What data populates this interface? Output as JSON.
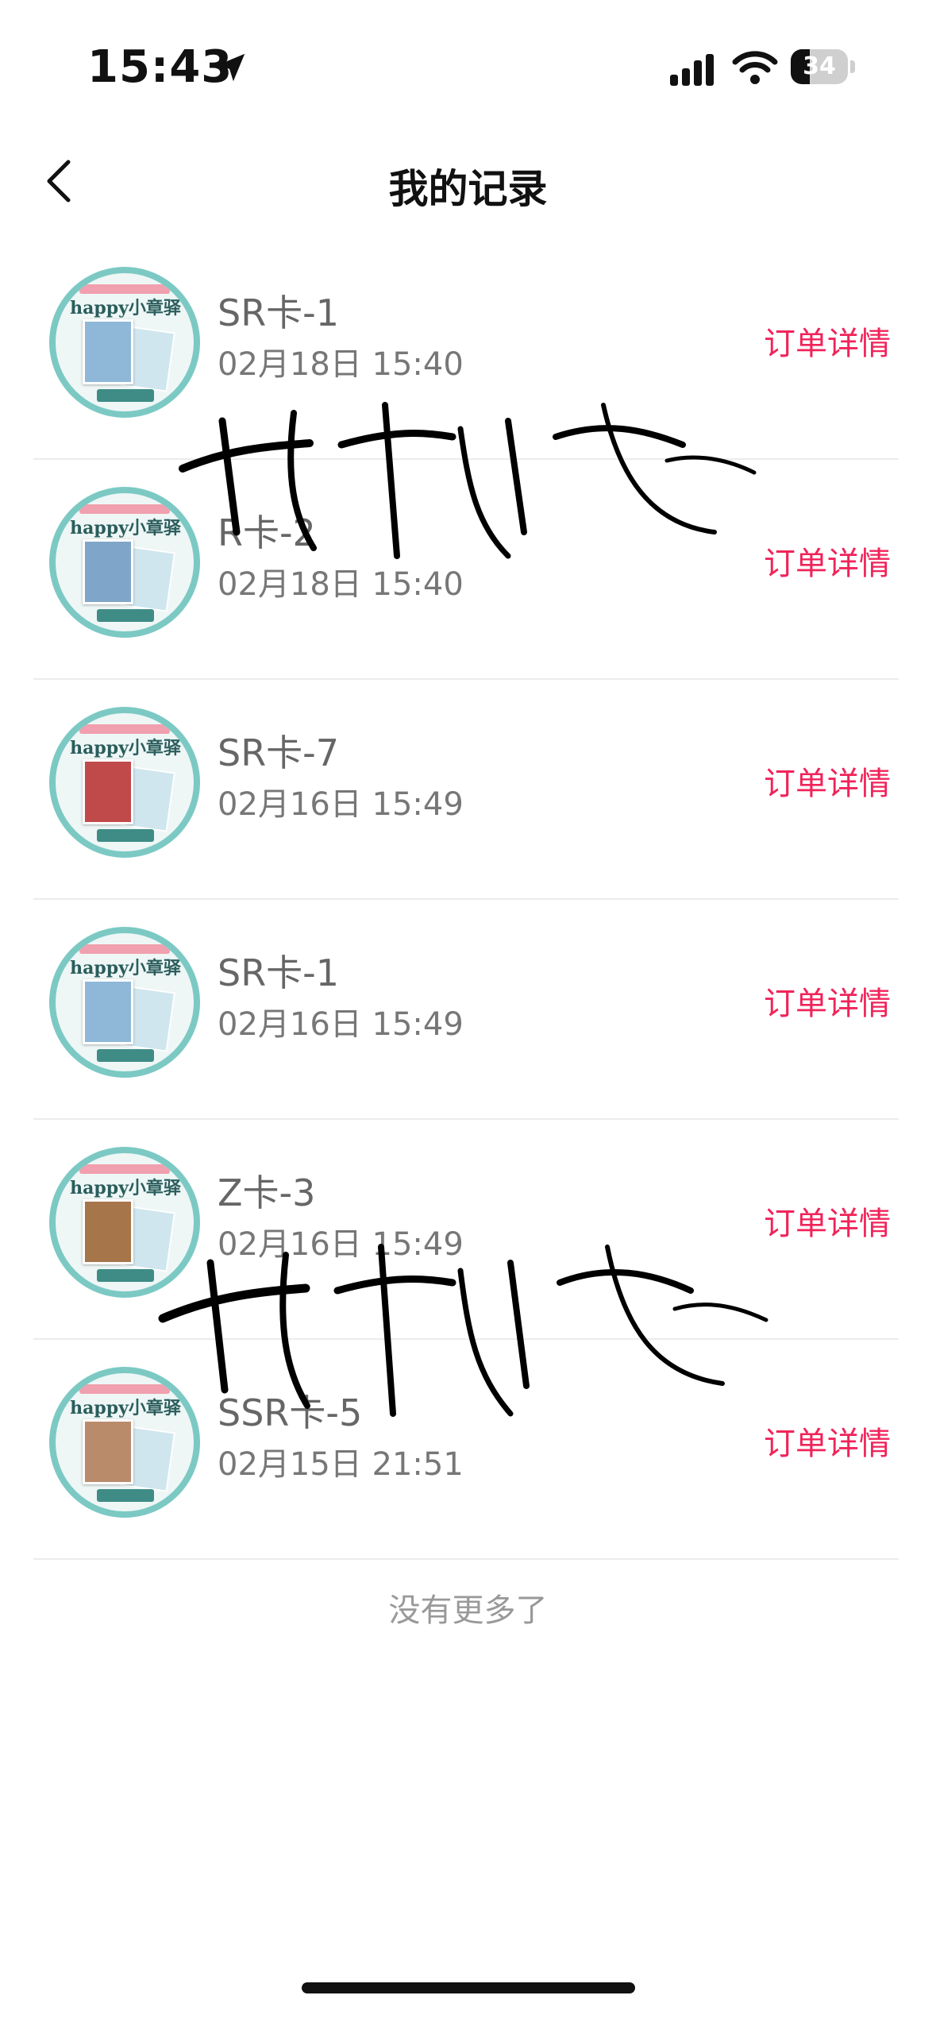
{
  "status_bar": {
    "time": "15:43",
    "battery": "34",
    "battery_level": 0.34
  },
  "nav": {
    "title": "我的记录",
    "back_icon": "chevron-left-icon"
  },
  "records": [
    {
      "title": "SR卡-1",
      "date": "02月18日 15:40",
      "action": "订单详情",
      "thumb_color": "#8fb8d8"
    },
    {
      "title": "R卡-2",
      "date": "02月18日 15:40",
      "action": "订单详情",
      "thumb_color": "#7fa6c9"
    },
    {
      "title": "SR卡-7",
      "date": "02月16日 15:49",
      "action": "订单详情",
      "thumb_color": "#c04a4a"
    },
    {
      "title": "SR卡-1",
      "date": "02月16日 15:49",
      "action": "订单详情",
      "thumb_color": "#8fb8d8"
    },
    {
      "title": "Z卡-3",
      "date": "02月16日 15:49",
      "action": "订单详情",
      "thumb_color": "#a6754a"
    },
    {
      "title": "SSR卡-5",
      "date": "02月15日 21:51",
      "action": "订单详情",
      "thumb_color": "#b98b6a"
    }
  ],
  "thumbnail": {
    "brand": "happy小章驿站"
  },
  "end_text": "没有更多了",
  "colors": {
    "accent": "#f0245a",
    "avatar_ring": "#7cc9c4"
  }
}
